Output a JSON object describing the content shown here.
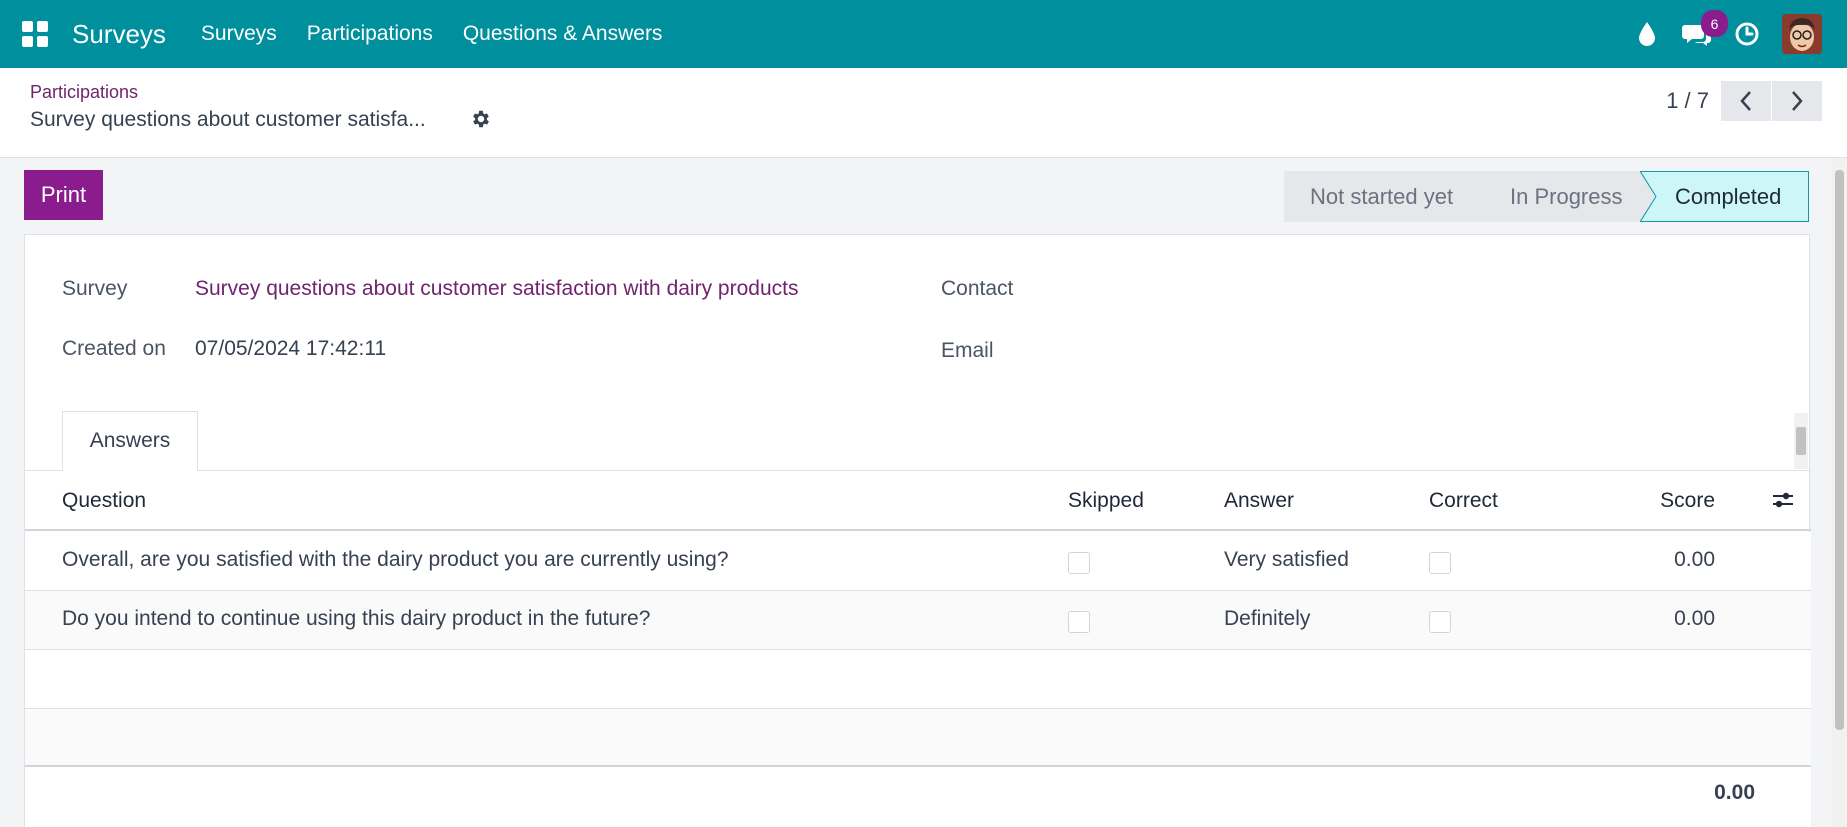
{
  "navbar": {
    "brand": "Surveys",
    "menu": [
      "Surveys",
      "Participations",
      "Questions & Answers"
    ],
    "message_count": "6",
    "icons": [
      "apps-grid-icon",
      "drop-icon",
      "chat-icon",
      "clock-icon"
    ],
    "color": "#008f9c"
  },
  "control": {
    "breadcrumb": "Participations",
    "title": "Survey questions about customer satisfa...",
    "pager": "1 / 7"
  },
  "actions": {
    "print_label": "Print"
  },
  "statusbar": {
    "stages": [
      "Not started yet",
      "In Progress",
      "Completed"
    ],
    "active": "Completed"
  },
  "form": {
    "survey_label": "Survey",
    "survey_value": "Survey questions about customer satisfaction with dairy products",
    "created_label": "Created on",
    "created_value": "07/05/2024 17:42:11",
    "contact_label": "Contact",
    "email_label": "Email"
  },
  "tabs": {
    "answers": "Answers"
  },
  "table": {
    "headers": {
      "question": "Question",
      "skipped": "Skipped",
      "answer": "Answer",
      "correct": "Correct",
      "score": "Score"
    },
    "rows": [
      {
        "question": "Overall, are you satisfied with the dairy product you are currently using?",
        "skipped": false,
        "answer": "Very satisfied",
        "correct": false,
        "score": "0.00"
      },
      {
        "question": "Do you intend to continue using this dairy product in the future?",
        "skipped": false,
        "answer": "Definitely",
        "correct": false,
        "score": "0.00"
      }
    ],
    "total": "0.00"
  },
  "colors": {
    "primary": "#8a1c8e",
    "link": "#71246e",
    "stage_active": "#cdf6f8"
  }
}
